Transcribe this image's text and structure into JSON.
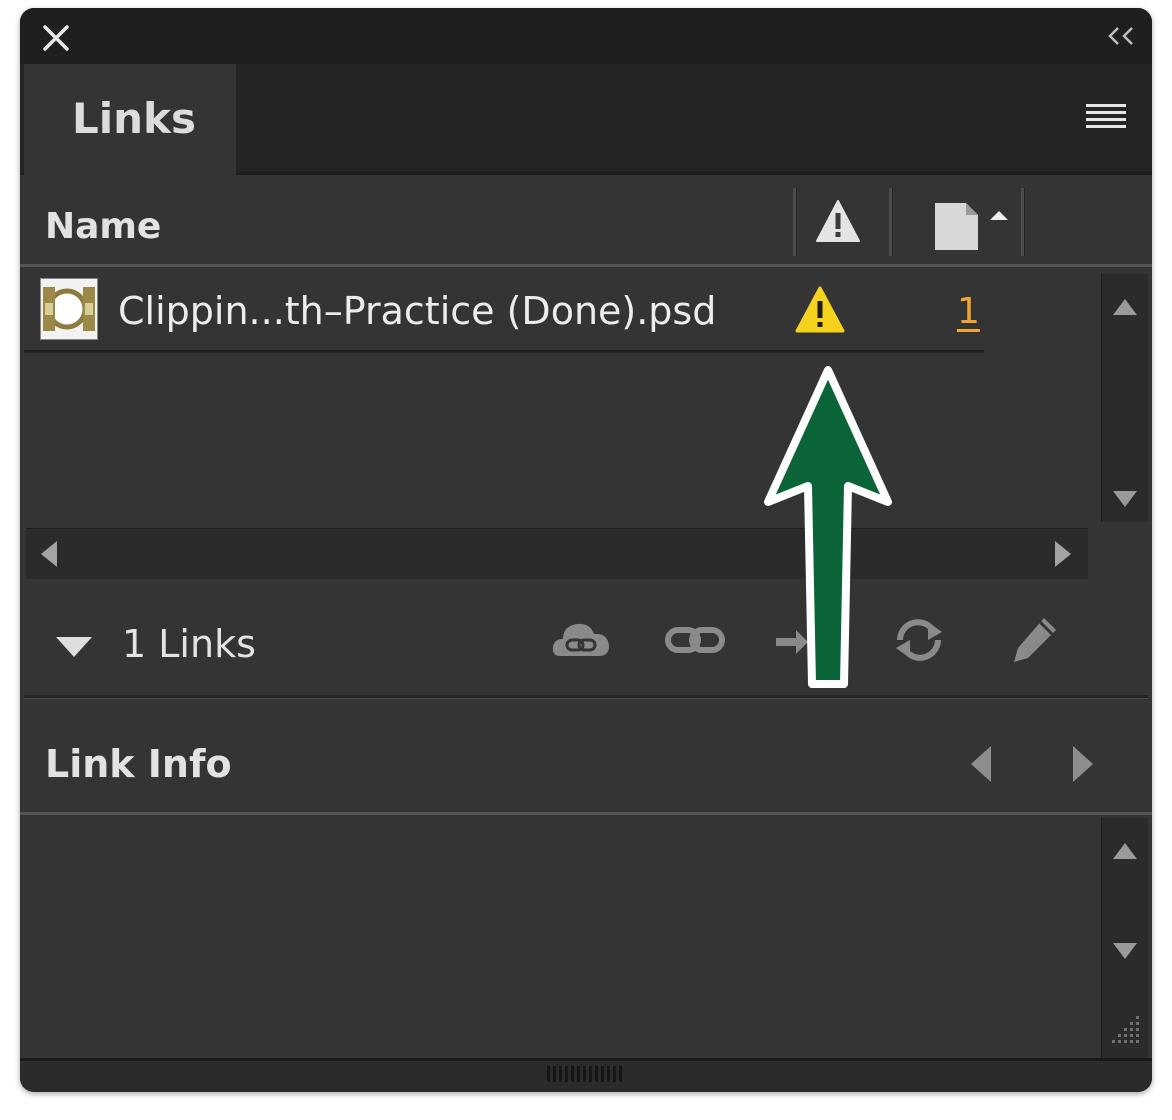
{
  "panel": {
    "tab_label": "Links",
    "columns": {
      "name": "Name",
      "status_icon": "warning-triangle-icon",
      "page_icon": "page-icon"
    },
    "rows": [
      {
        "filename": "Clippin...th–Practice (Done).psd",
        "status": "warning-icon",
        "page": "1"
      }
    ],
    "summary": {
      "count_label": "1 Links"
    },
    "toolbar_icons": [
      "cc-libraries-link-icon",
      "relink-icon",
      "go-to-link-icon",
      "update-link-icon",
      "edit-original-icon"
    ],
    "link_info": {
      "title": "Link Info"
    }
  },
  "colors": {
    "panel_bg": "#343434",
    "title_bar": "#1f1f1f",
    "warning": "#f5d21e",
    "page_link": "#f2a531",
    "annotation_arrow": "#0b6338"
  }
}
